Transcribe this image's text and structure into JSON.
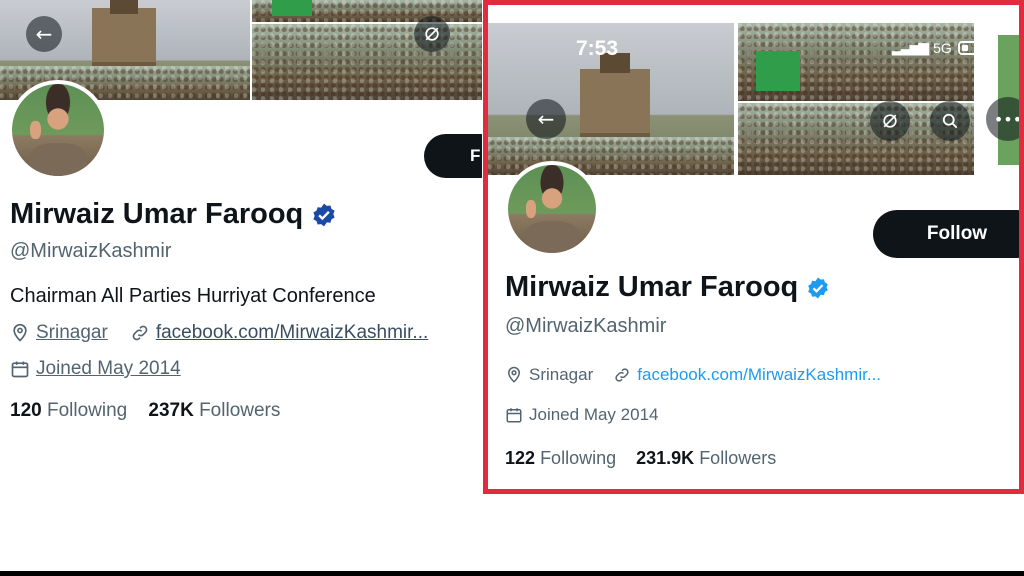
{
  "left_profile": {
    "name": "Mirwaiz Umar Farooq",
    "handle": "@MirwaizKashmir",
    "bio": "Chairman All Parties Hurriyat Conference",
    "location": "Srinagar",
    "website": "facebook.com/MirwaizKashmir...",
    "joined": "Joined May 2014",
    "following_count": "120",
    "following_label": "Following",
    "followers_count": "237K",
    "followers_label": "Followers",
    "follow_button_partial": "F"
  },
  "right_profile": {
    "status_time": "7:53",
    "network": "5G",
    "name": "Mirwaiz Umar Farooq",
    "handle": "@MirwaizKashmir",
    "location": "Srinagar",
    "website": "facebook.com/MirwaizKashmir...",
    "joined": "Joined May 2014",
    "following_count": "122",
    "following_label": "Following",
    "followers_count": "231.9K",
    "followers_label": "Followers",
    "follow_button": "Follow"
  },
  "colors": {
    "highlight_border": "#e32b3f",
    "verified_badge_left": "#1a4aa6",
    "verified_badge_right": "#1d9bf0",
    "link_right": "#1d9bf0",
    "button_bg": "#0f1419"
  },
  "icons": [
    "back-arrow-icon",
    "refresh-icon",
    "search-icon",
    "more-icon",
    "location-pin-icon",
    "link-icon",
    "calendar-icon",
    "verified-badge-icon",
    "signal-icon",
    "battery-icon"
  ]
}
